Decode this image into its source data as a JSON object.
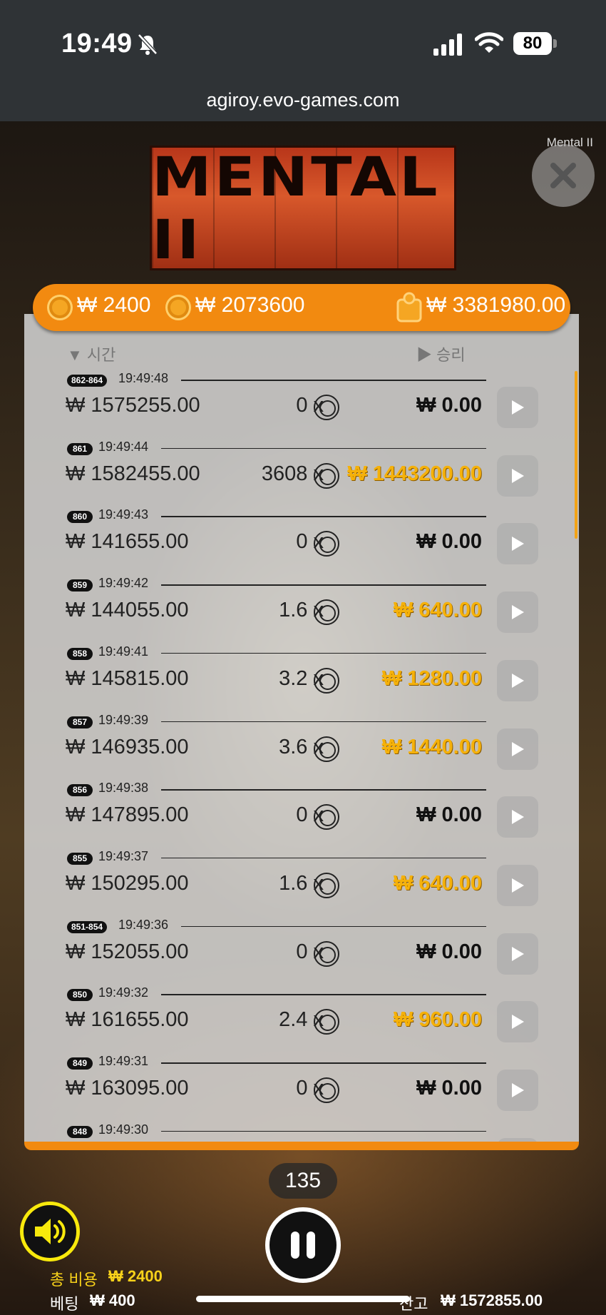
{
  "status_bar": {
    "time": "19:49",
    "battery": "80",
    "url": "agiroy.evo-games.com"
  },
  "game": {
    "name_label": "Mental II",
    "logo_text": "MENTAL II"
  },
  "header": {
    "bet_amount": "₩ 2400",
    "max_win": "₩ 2073600",
    "balance": "₩ 3381980.00"
  },
  "columns": {
    "time": "시간",
    "win": "승리"
  },
  "history": [
    {
      "id": "862-864",
      "time": "19:49:48",
      "balance": "₩ 1575255.00",
      "multiplier": "0 x",
      "win": "₩ 0.00",
      "is_win": false
    },
    {
      "id": "861",
      "time": "19:49:44",
      "balance": "₩ 1582455.00",
      "multiplier": "3608 x",
      "win": "₩ 1443200.00",
      "is_win": true
    },
    {
      "id": "860",
      "time": "19:49:43",
      "balance": "₩ 141655.00",
      "multiplier": "0 x",
      "win": "₩ 0.00",
      "is_win": false
    },
    {
      "id": "859",
      "time": "19:49:42",
      "balance": "₩ 144055.00",
      "multiplier": "1.6 x",
      "win": "₩ 640.00",
      "is_win": true
    },
    {
      "id": "858",
      "time": "19:49:41",
      "balance": "₩ 145815.00",
      "multiplier": "3.2 x",
      "win": "₩ 1280.00",
      "is_win": true
    },
    {
      "id": "857",
      "time": "19:49:39",
      "balance": "₩ 146935.00",
      "multiplier": "3.6 x",
      "win": "₩ 1440.00",
      "is_win": true
    },
    {
      "id": "856",
      "time": "19:49:38",
      "balance": "₩ 147895.00",
      "multiplier": "0 x",
      "win": "₩ 0.00",
      "is_win": false
    },
    {
      "id": "855",
      "time": "19:49:37",
      "balance": "₩ 150295.00",
      "multiplier": "1.6 x",
      "win": "₩ 640.00",
      "is_win": true
    },
    {
      "id": "851-854",
      "time": "19:49:36",
      "balance": "₩ 152055.00",
      "multiplier": "0 x",
      "win": "₩ 0.00",
      "is_win": false
    },
    {
      "id": "850",
      "time": "19:49:32",
      "balance": "₩ 161655.00",
      "multiplier": "2.4 x",
      "win": "₩ 960.00",
      "is_win": true
    },
    {
      "id": "849",
      "time": "19:49:31",
      "balance": "₩ 163095.00",
      "multiplier": "0 x",
      "win": "₩ 0.00",
      "is_win": false
    },
    {
      "id": "848",
      "time": "19:49:30",
      "balance": "",
      "multiplier": "",
      "win": "",
      "is_win": false
    }
  ],
  "controls": {
    "round_count": "135",
    "total_cost_label": "총 비용",
    "total_cost_value": "₩ 2400",
    "bet_label": "베팅",
    "bet_value": "₩ 400",
    "balance_label": "잔고",
    "balance_value": "₩ 1572855.00"
  },
  "colors": {
    "accent_orange": "#f28a10",
    "win_gold": "#f5b10a",
    "sound_yellow": "#f8e90c"
  }
}
